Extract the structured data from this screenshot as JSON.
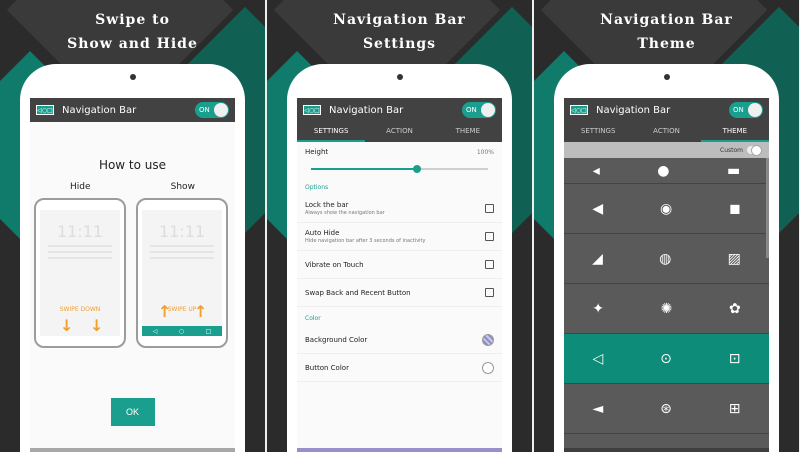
{
  "panels": [
    {
      "caption_line1": "Swipe to",
      "caption_line2": "Show and Hide"
    },
    {
      "caption_line1": "Navigation Bar",
      "caption_line2": "Settings"
    },
    {
      "caption_line1": "Navigation Bar",
      "caption_line2": "Theme"
    }
  ],
  "app": {
    "title": "Navigation Bar",
    "toggle_label": "ON",
    "icon_text": "◁○□"
  },
  "nav": {
    "back": "◁",
    "home": "○",
    "recent": "□"
  },
  "howto": {
    "heading": "How to use",
    "hide_label": "Hide",
    "show_label": "Show",
    "clock": "11:11",
    "swipe_down": "SWIPE DOWN",
    "swipe_up": "SWIPE UP",
    "ok": "OK"
  },
  "tabs": [
    "SETTINGS",
    "ACTION",
    "THEME"
  ],
  "settings": {
    "height_label": "Height",
    "height_value": "100%",
    "height_fraction": 0.6,
    "options_header": "Options",
    "rows": [
      {
        "title": "Lock the bar",
        "subtitle": "Always show the navigation bar"
      },
      {
        "title": "Auto Hide",
        "subtitle": "Hide navigation bar after 3 seconds of inactivity"
      },
      {
        "title": "Vibrate on Touch",
        "subtitle": ""
      },
      {
        "title": "Swap Back and Recent Button",
        "subtitle": ""
      }
    ],
    "color_header": "Color",
    "background_color_label": "Background Color",
    "button_color_label": "Button Color"
  },
  "theme": {
    "custom_label": "Custom",
    "rows": [
      [
        "◂",
        "●",
        "▬"
      ],
      [
        "◀",
        "◉",
        "◼"
      ],
      [
        "◢",
        "◍",
        "▨"
      ],
      [
        "✦",
        "✺",
        "✿"
      ],
      [
        "◁",
        "⊙",
        "⊡"
      ],
      [
        "◄",
        "⊛",
        "⊞"
      ]
    ],
    "selected_row": 4,
    "accent": "#0d8c7a"
  },
  "colors": {
    "accent": "#1a9f8e",
    "appbar": "#424242"
  }
}
